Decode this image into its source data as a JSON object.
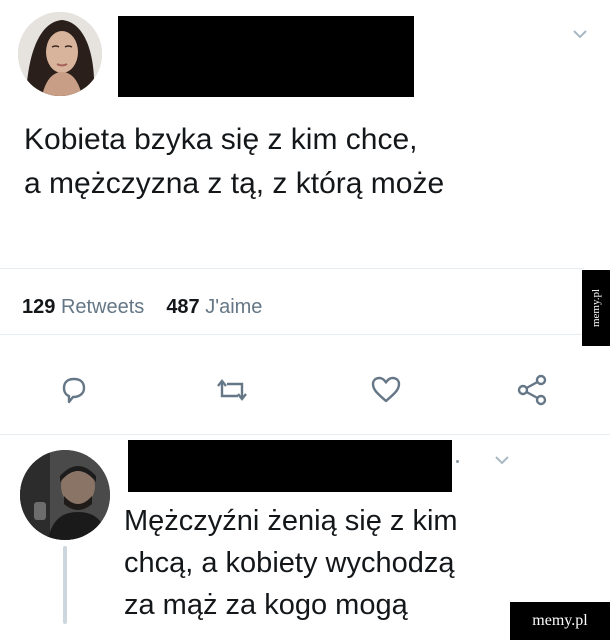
{
  "tweet": {
    "author_redacted": true,
    "text_line1": "Kobieta bzyka się z kim chce,",
    "text_line2": "a mężczyzna z tą, z którą może",
    "retweets_count": "129",
    "retweets_label": "Retweets",
    "likes_count": "487",
    "likes_label": "J'aime",
    "actions": [
      "reply-icon",
      "retweet-icon",
      "like-icon",
      "share-icon"
    ]
  },
  "reply": {
    "author_redacted": true,
    "text_line1": "Mężczyźni żenią się z kim",
    "text_line2": "chcą, a kobiety wychodzą",
    "text_line3": "za mąż za kogo mogą"
  },
  "watermark": {
    "side": "memy.pl",
    "bottom": "memy.pl"
  },
  "colors": {
    "icon": "#657786",
    "divider": "#e6ecf0",
    "text": "#14171a"
  }
}
